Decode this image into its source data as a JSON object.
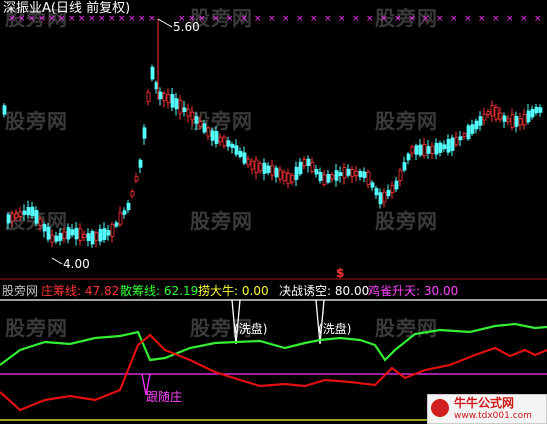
{
  "header": {
    "title": "深振业A(日线 前复权)"
  },
  "price_panel": {
    "high_label": "5.60",
    "low_label": "4.00"
  },
  "indicator_panel": {
    "watermark": "股旁网",
    "items": [
      {
        "label": "庄筹线:",
        "value": "47.82",
        "color": "#ff3333"
      },
      {
        "label": "散筹线:",
        "value": "62.19",
        "color": "#33ff33"
      },
      {
        "label": "捞大牛:",
        "value": "0.00",
        "color": "#ffff33"
      },
      {
        "label": "决战诱空:",
        "value": "80.00",
        "color": "#ffffff"
      },
      {
        "label": "鸡雀升天:",
        "value": "30.00",
        "color": "#ff44ff"
      }
    ],
    "signal_mark": "$",
    "annotations": {
      "wash1": "洗盘",
      "wash2": "洗盘",
      "follow": "跟随庄"
    }
  },
  "watermarks": [
    "股旁网",
    "股旁网",
    "股旁网",
    "股旁网",
    "股旁网",
    "股旁网",
    "股旁网",
    "股旁网",
    "股旁网",
    "股旁网",
    "股旁网",
    "股旁网"
  ],
  "logo": {
    "text1": "牛牛公式网",
    "text2": "www.tdx001.com"
  },
  "colors": {
    "up": "#ff3333",
    "down": "#54ffff",
    "zhuang": "#e01010",
    "san": "#33ee33",
    "magenta": "#ff33ff",
    "white": "#ffffff"
  }
}
